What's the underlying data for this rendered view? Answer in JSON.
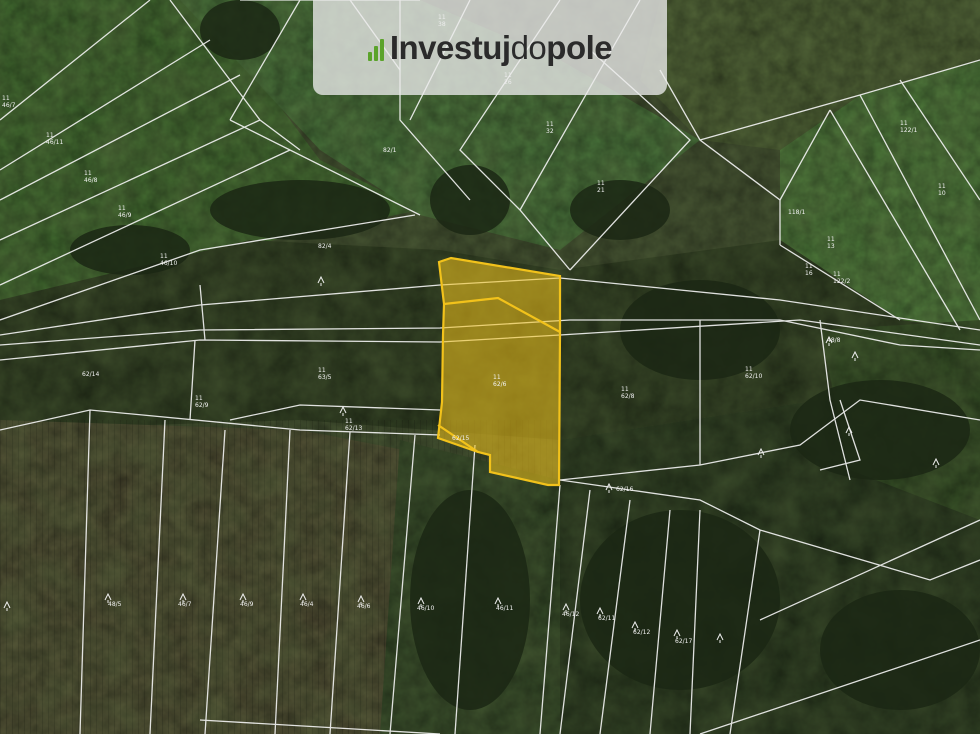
{
  "brand": {
    "part1": "Investuj",
    "part2": "do",
    "part3": "pole",
    "accent": "#5ba32b"
  },
  "highlight_color": "#f2c21b",
  "parcel_labels": [
    {
      "text": "11\n46/7"
    },
    {
      "text": "11\n46/11"
    },
    {
      "text": "11\n46/8"
    },
    {
      "text": "11\n46/9"
    },
    {
      "text": "11\n46/10"
    },
    {
      "text": "82/1"
    },
    {
      "text": "11\n32"
    },
    {
      "text": "11\n21"
    },
    {
      "text": "11\n38"
    },
    {
      "text": "11\n26"
    },
    {
      "text": "11\n122/1"
    },
    {
      "text": "11\n13"
    },
    {
      "text": "11\n122/2"
    },
    {
      "text": "82/4"
    },
    {
      "text": "118/1"
    },
    {
      "text": "11\n10"
    },
    {
      "text": "11\n62/6"
    },
    {
      "text": "11\n62/8"
    },
    {
      "text": "11\n62/10"
    },
    {
      "text": "11\n63/5"
    },
    {
      "text": "11\n62/9"
    },
    {
      "text": "11\n62/13"
    },
    {
      "text": "62/14"
    },
    {
      "text": "62/15"
    },
    {
      "text": "62/16"
    },
    {
      "text": "48/8"
    },
    {
      "text": "46/7"
    },
    {
      "text": "46/9"
    },
    {
      "text": "48/5"
    },
    {
      "text": "46/4"
    },
    {
      "text": "46/6"
    },
    {
      "text": "46/10"
    },
    {
      "text": "46/11"
    },
    {
      "text": "46/12"
    },
    {
      "text": "62/11"
    },
    {
      "text": "62/12"
    },
    {
      "text": "62/17"
    },
    {
      "text": "11\n16"
    }
  ]
}
